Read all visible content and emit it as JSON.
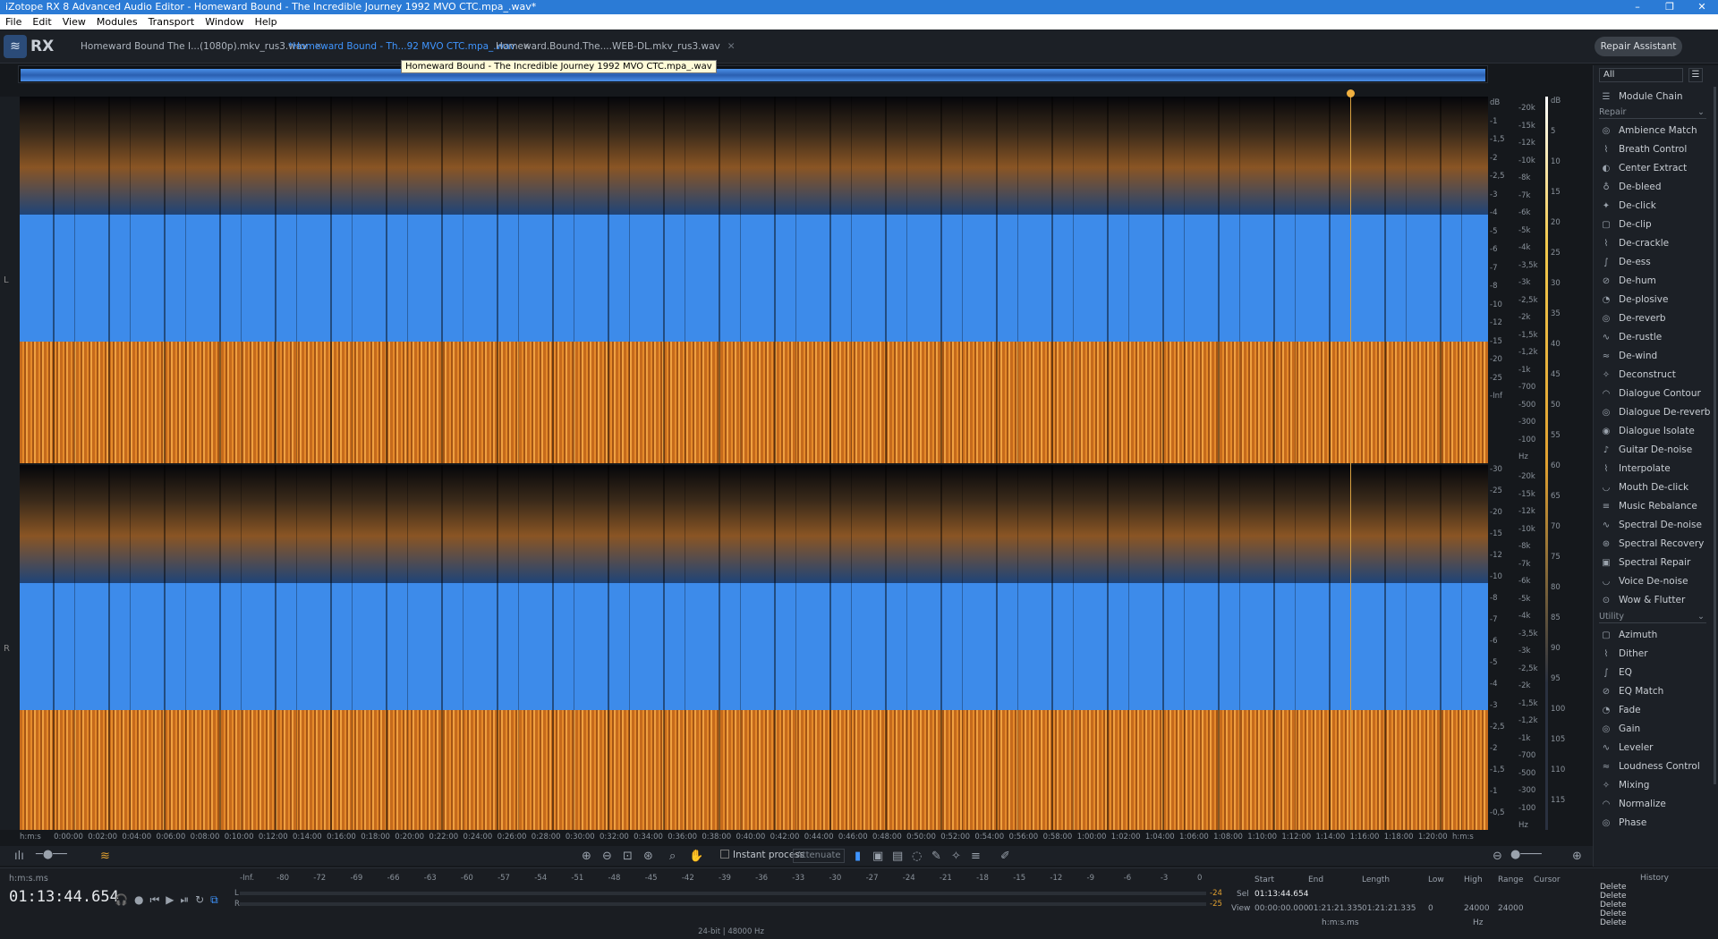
{
  "window": {
    "title": "iZotope RX 8 Advanced Audio Editor - Homeward Bound - The Incredible Journey 1992 MVO CTC.mpa_.wav*"
  },
  "menu": [
    "File",
    "Edit",
    "View",
    "Modules",
    "Transport",
    "Window",
    "Help"
  ],
  "logo": {
    "text": "RX"
  },
  "tabs": [
    {
      "label": "Homeward Bound The I...(1080p).mkv_rus3.wav"
    },
    {
      "label": "*Homeward Bound - Th...92 MVO CTC.mpa_.wav"
    },
    {
      "label": "Homeward.Bound.The....WEB-DL.mkv_rus3.wav"
    }
  ],
  "repair_assistant": "Repair Assistant",
  "overview_tooltip": "Homeward Bound - The Incredible Journey 1992 MVO CTC.mpa_.wav",
  "channels": {
    "left": "L",
    "right": "R"
  },
  "db_scale": [
    "dB",
    "-1",
    "-1,5",
    "-2",
    "-2,5",
    "-3",
    "-4",
    "-5",
    "-6",
    "-7",
    "-8",
    "-10",
    "-12",
    "-15",
    "-20",
    "-25",
    "-Inf",
    "-30",
    "-25",
    "-20",
    "-15",
    "-12",
    "-10",
    "-8",
    "-7",
    "-6",
    "-5",
    "-4",
    "-3",
    "-2,5",
    "-2",
    "-1,5",
    "-1",
    "-0,5"
  ],
  "hz_scale": [
    "-20k",
    "-15k",
    "-12k",
    "-10k",
    "-8k",
    "-7k",
    "-6k",
    "-5k",
    "-4k",
    "-3,5k",
    "-3k",
    "-2,5k",
    "-2k",
    "-1,5k",
    "-1,2k",
    "-1k",
    "-700",
    "-500",
    "-300",
    "-100",
    "Hz"
  ],
  "meter_scale": [
    "dB",
    "5",
    "10",
    "15",
    "20",
    "25",
    "30",
    "35",
    "40",
    "45",
    "50",
    "55",
    "60",
    "65",
    "70",
    "75",
    "80",
    "85",
    "90",
    "95",
    "100",
    "105",
    "110",
    "115"
  ],
  "time_ruler": [
    "h:m:s",
    "0:00:00",
    "0:02:00",
    "0:04:00",
    "0:06:00",
    "0:08:00",
    "0:10:00",
    "0:12:00",
    "0:14:00",
    "0:16:00",
    "0:18:00",
    "0:20:00",
    "0:22:00",
    "0:24:00",
    "0:26:00",
    "0:28:00",
    "0:30:00",
    "0:32:00",
    "0:34:00",
    "0:36:00",
    "0:38:00",
    "0:40:00",
    "0:42:00",
    "0:44:00",
    "0:46:00",
    "0:48:00",
    "0:50:00",
    "0:52:00",
    "0:54:00",
    "0:56:00",
    "0:58:00",
    "1:00:00",
    "1:02:00",
    "1:04:00",
    "1:06:00",
    "1:08:00",
    "1:10:00",
    "1:12:00",
    "1:14:00",
    "1:16:00",
    "1:18:00",
    "1:20:00",
    "h:m:s"
  ],
  "toolbar": {
    "instant_process": "Instant process",
    "attenuate": "Attenuate"
  },
  "timecode": {
    "format": "h:m:s.ms",
    "value": "01:13:44.654"
  },
  "level_meter": {
    "scale": [
      "-Inf.",
      "-80",
      "-72",
      "-69",
      "-66",
      "-63",
      "-60",
      "-57",
      "-54",
      "-51",
      "-48",
      "-45",
      "-42",
      "-39",
      "-36",
      "-33",
      "-30",
      "-27",
      "-24",
      "-21",
      "-18",
      "-15",
      "-12",
      "-9",
      "-6",
      "-3",
      "0"
    ],
    "l_peak": "-24",
    "r_peak": "-25",
    "format": "24-bit | 48000 Hz",
    "l": "L",
    "r": "R"
  },
  "selection": {
    "start_label": "Start",
    "end_label": "End",
    "length_label": "Length",
    "sel_label": "Sel",
    "view_label": "View",
    "sel_start": "01:13:44.654",
    "view_start": "00:00:00.000",
    "view_end": "01:21:21.335",
    "view_length": "01:21:21.335",
    "unit": "h:m:s.ms"
  },
  "frequency": {
    "low_label": "Low",
    "high_label": "High",
    "range_label": "Range",
    "cursor_label": "Cursor",
    "low": "0",
    "high": "24000",
    "range": "24000",
    "unit": "Hz"
  },
  "history": {
    "title": "History",
    "items": [
      "Delete",
      "Delete",
      "Delete",
      "Delete",
      "Delete"
    ]
  },
  "modules": {
    "filter": "All",
    "chain": "Module Chain",
    "repair_title": "Repair",
    "repair": [
      "Ambience Match",
      "Breath Control",
      "Center Extract",
      "De-bleed",
      "De-click",
      "De-clip",
      "De-crackle",
      "De-ess",
      "De-hum",
      "De-plosive",
      "De-reverb",
      "De-rustle",
      "De-wind",
      "Deconstruct",
      "Dialogue Contour",
      "Dialogue De-reverb",
      "Dialogue Isolate",
      "Guitar De-noise",
      "Interpolate",
      "Mouth De-click",
      "Music Rebalance",
      "Spectral De-noise",
      "Spectral Recovery",
      "Spectral Repair",
      "Voice De-noise",
      "Wow & Flutter"
    ],
    "utility_title": "Utility",
    "utility": [
      "Azimuth",
      "Dither",
      "EQ",
      "EQ Match",
      "Fade",
      "Gain",
      "Leveler",
      "Loudness Control",
      "Mixing",
      "Normalize",
      "Phase"
    ]
  },
  "colors": {
    "accent": "#3f95ff",
    "titlebar": "#2b7bd6"
  }
}
